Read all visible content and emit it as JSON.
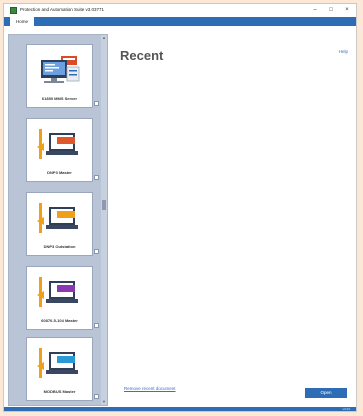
{
  "window": {
    "title": "Protection and Automation Suite v3.03771",
    "controls": {
      "minimize": "–",
      "maximize": "□",
      "close": "×"
    }
  },
  "ribbon": {
    "home_tab": "Home"
  },
  "sidebar": {
    "cards": [
      {
        "label": "61850 MMS Server",
        "icon": "server-monitor-icon",
        "accent": "#d84a2a"
      },
      {
        "label": "DNP3 Master",
        "icon": "laptop-device-icon",
        "accent": "#e0572b"
      },
      {
        "label": "DNP3 Outstation",
        "icon": "laptop-device-icon",
        "accent": "#f0a018"
      },
      {
        "label": "60870-5-104 Master",
        "icon": "laptop-device-icon",
        "accent": "#8a3ab0"
      },
      {
        "label": "MODBUS Master",
        "icon": "laptop-device-icon",
        "accent": "#2a9ad6"
      }
    ]
  },
  "main": {
    "title": "Recent",
    "help": "Help",
    "remove_recent": "Remove recent document",
    "open_button": "Open"
  },
  "status": {
    "text": "v3.03"
  },
  "colors": {
    "accent": "#2e6db5",
    "sidebar": "#b9c4d6",
    "background": "#fbe8d6"
  }
}
